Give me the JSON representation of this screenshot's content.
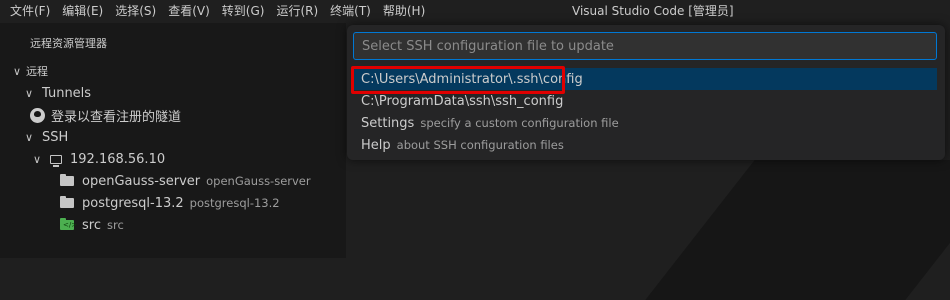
{
  "menu": [
    "文件(F)",
    "编辑(E)",
    "选择(S)",
    "查看(V)",
    "转到(G)",
    "运行(R)",
    "终端(T)",
    "帮助(H)"
  ],
  "window_title": "Visual Studio Code [管理员]",
  "sidebar": {
    "header": "远程资源管理器",
    "section": "远程",
    "tunnels_label": "Tunnels",
    "tunnels_signin": "登录以查看注册的隧道",
    "ssh_label": "SSH",
    "host": "192.168.56.10",
    "folders": [
      {
        "name": "openGauss-server",
        "desc": "openGauss-server"
      },
      {
        "name": "postgresql-13.2",
        "desc": "postgresql-13.2"
      },
      {
        "name": "src",
        "desc": "src"
      }
    ]
  },
  "quick_pick": {
    "placeholder": "Select SSH configuration file to update",
    "items": [
      {
        "label": "C:\\Users\\Administrator\\.ssh\\config",
        "detail": ""
      },
      {
        "label": "C:\\ProgramData\\ssh\\ssh_config",
        "detail": ""
      },
      {
        "label": "Settings",
        "detail": "specify a custom configuration file"
      },
      {
        "label": "Help",
        "detail": "about SSH configuration files"
      }
    ]
  },
  "colors": {
    "accent": "#0078d4",
    "highlight": "#e00000",
    "active_item": "#04395e"
  }
}
